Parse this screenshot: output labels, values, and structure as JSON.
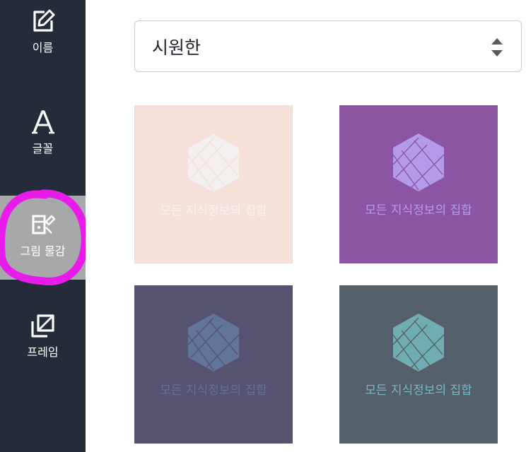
{
  "sidebar": {
    "items": [
      {
        "label": "이름",
        "icon": "edit-icon"
      },
      {
        "label": "글꼴",
        "icon": "font-icon"
      },
      {
        "label": "그림 물감",
        "icon": "paint-icon",
        "active": true
      },
      {
        "label": "프레임",
        "icon": "frame-icon"
      }
    ]
  },
  "style_select": {
    "value": "시원한"
  },
  "cards": [
    {
      "text": "모든 지식정보의 집합",
      "bg": "#f5e0da",
      "fg": "#f6f1f0",
      "hex": "#f3f0ef"
    },
    {
      "text": "모든 지식정보의 집합",
      "bg": "#8a55a2",
      "fg": "#b59ae9",
      "hex": "#b39be9"
    },
    {
      "text": "모든 지식정보의 집합",
      "bg": "#555370",
      "fg": "#657095",
      "hex": "#627497"
    },
    {
      "text": "모든 지식정보의 집합",
      "bg": "#555f6a",
      "fg": "#76b7c4",
      "hex": "#6fadb3"
    }
  ],
  "colors": {
    "sidebar": "#232c38",
    "active_item": "#a6a8aa",
    "highlight": "#e81bea"
  }
}
